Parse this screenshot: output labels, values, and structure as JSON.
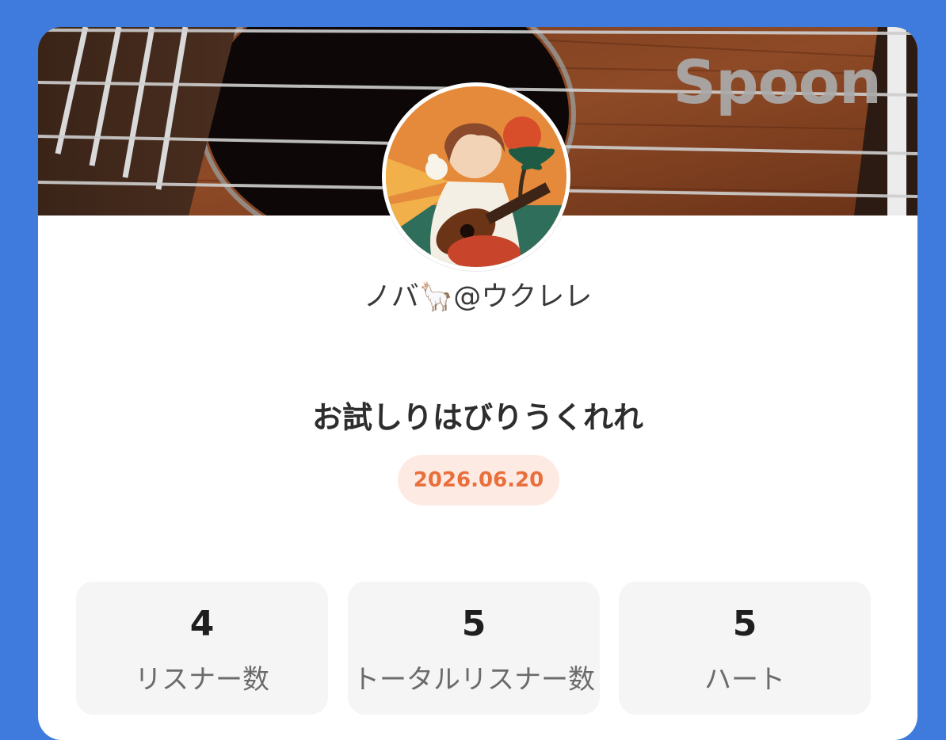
{
  "brand": {
    "logo_text": "Spoon",
    "background_color": "#3f7bdc",
    "accent_color": "#e96f3b"
  },
  "profile": {
    "username": "ノバ🦙@ウクレレ",
    "avatar_icon": "ukulele-girl-avatar"
  },
  "broadcast": {
    "title": "お試しりはびりうくれれ",
    "date": "2026.06.20"
  },
  "stats": [
    {
      "value": "4",
      "label": "リスナー数"
    },
    {
      "value": "5",
      "label": "トータルリスナー数"
    },
    {
      "value": "5",
      "label": "ハート"
    }
  ]
}
